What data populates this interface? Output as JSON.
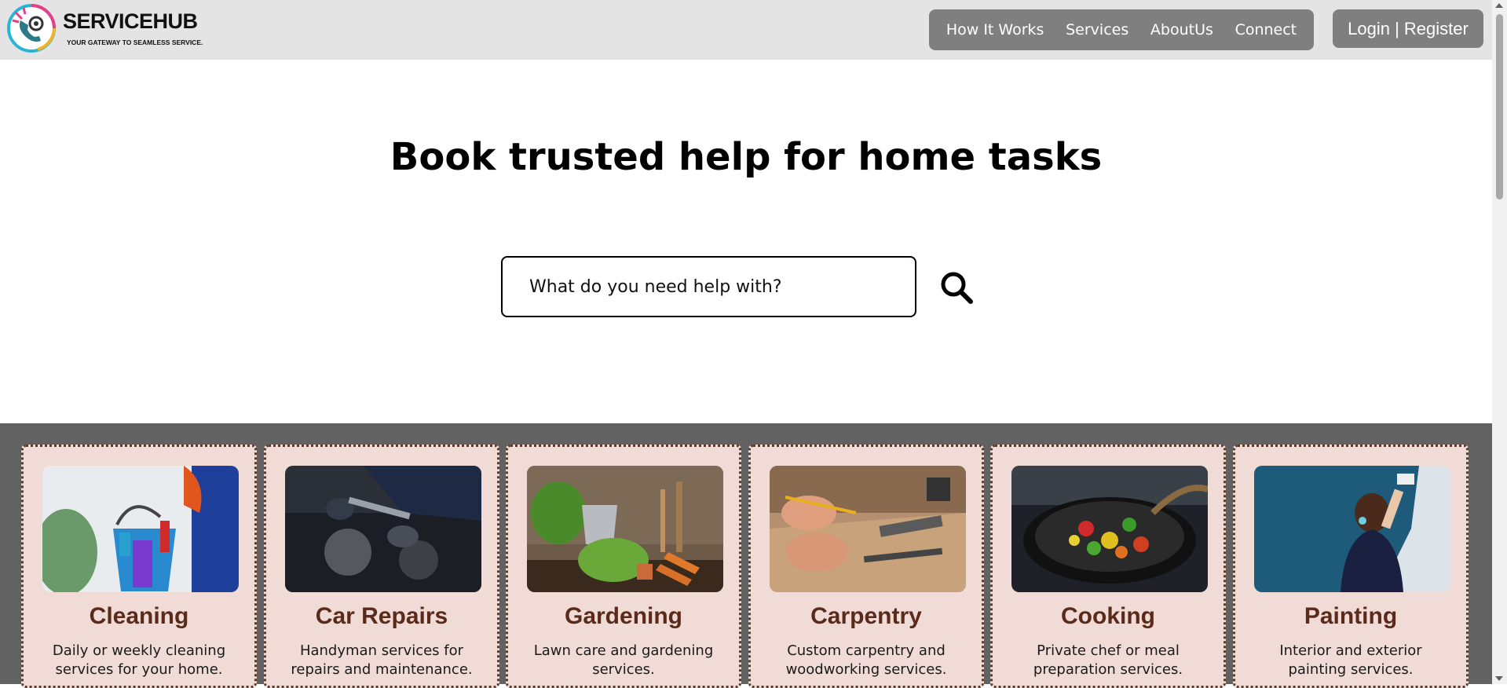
{
  "header": {
    "brand": "SERVICEHUB",
    "tagline": "YOUR GATEWAY TO SEAMLESS SERVICE.",
    "nav": [
      "How It Works",
      "Services",
      "AboutUs",
      "Connect"
    ],
    "login_label": "Login | Register"
  },
  "hero": {
    "title": "Book trusted help for home tasks",
    "search_placeholder": "What do you need help with?"
  },
  "services": [
    {
      "title": "Cleaning",
      "description": "Daily or weekly cleaning services for your home.",
      "image": "cleaning-photo"
    },
    {
      "title": "Car Repairs",
      "description": "Handyman services for repairs and maintenance.",
      "image": "car-repair-photo"
    },
    {
      "title": "Gardening",
      "description": "Lawn care and gardening services.",
      "image": "gardening-photo"
    },
    {
      "title": "Carpentry",
      "description": "Custom carpentry and woodworking services.",
      "image": "carpentry-photo"
    },
    {
      "title": "Cooking",
      "description": "Private chef or meal preparation services.",
      "image": "cooking-photo"
    },
    {
      "title": "Painting",
      "description": "Interior and exterior painting services.",
      "image": "painting-photo"
    }
  ],
  "colors": {
    "header_bg": "#e4e4e4",
    "nav_bg": "#7f7f7f",
    "band_bg": "#626262",
    "card_bg": "#f1dbd6",
    "card_title": "#5a2a1a"
  },
  "icons": {
    "search": "search-icon",
    "logo": "phone-gear-logo-icon"
  }
}
